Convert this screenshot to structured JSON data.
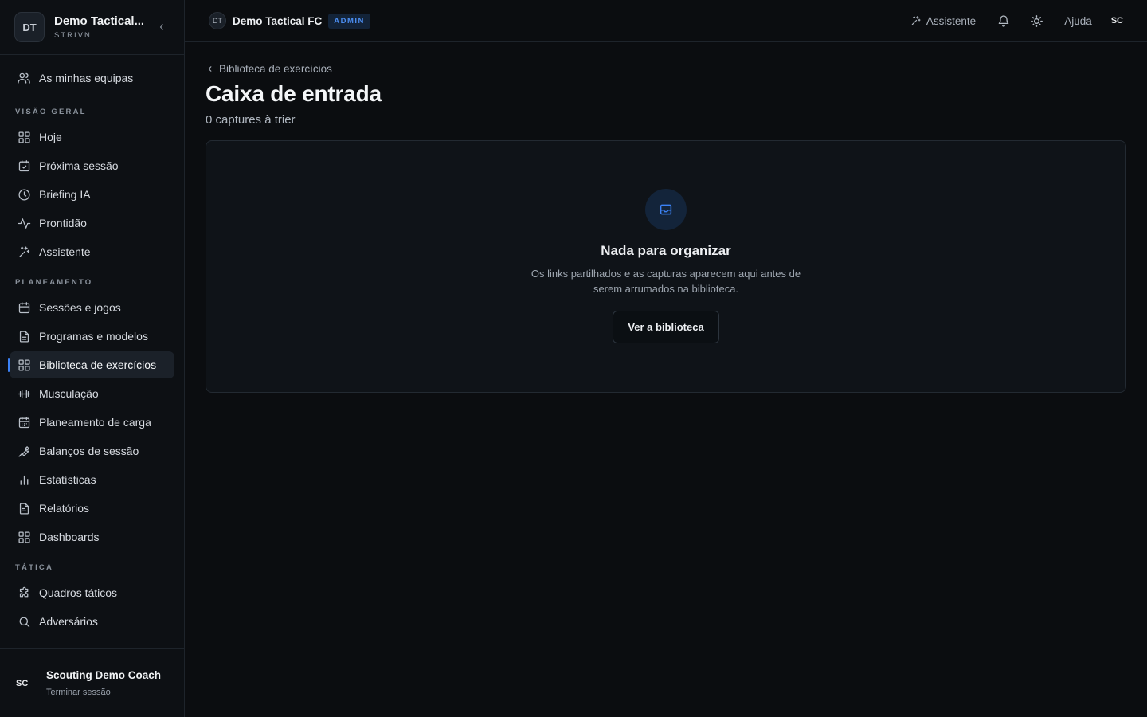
{
  "team": {
    "avatar": "DT",
    "name": "Demo Tactical...",
    "sub": "STRIVN"
  },
  "sidebar": {
    "my_teams": "As minhas equipas",
    "sections": [
      {
        "label": "VISÃO GERAL",
        "items": [
          {
            "label": "Hoje",
            "icon": "grid-icon"
          },
          {
            "label": "Próxima sessão",
            "icon": "calendar-check-icon"
          },
          {
            "label": "Briefing IA",
            "icon": "clock-icon"
          },
          {
            "label": "Prontidão",
            "icon": "activity-icon"
          },
          {
            "label": "Assistente",
            "icon": "sparkles-icon"
          }
        ]
      },
      {
        "label": "PLANEAMENTO",
        "items": [
          {
            "label": "Sessões e jogos",
            "icon": "calendar-icon"
          },
          {
            "label": "Programas e modelos",
            "icon": "document-icon"
          },
          {
            "label": "Biblioteca de exercícios",
            "icon": "grid-icon",
            "active": true
          },
          {
            "label": "Musculação",
            "icon": "dumbbell-icon"
          },
          {
            "label": "Planeamento de carga",
            "icon": "calendar-grid-icon"
          },
          {
            "label": "Balanços de sessão",
            "icon": "wrench-icon"
          },
          {
            "label": "Estatísticas",
            "icon": "bar-chart-icon"
          },
          {
            "label": "Relatórios",
            "icon": "report-icon"
          },
          {
            "label": "Dashboards",
            "icon": "grid-icon"
          }
        ]
      },
      {
        "label": "TÁTICA",
        "items": [
          {
            "label": "Quadros táticos",
            "icon": "puzzle-icon"
          },
          {
            "label": "Adversários",
            "icon": "search-icon"
          }
        ]
      }
    ]
  },
  "user": {
    "initials": "SC",
    "name": "Scouting Demo Coach",
    "logout": "Terminar sessão"
  },
  "topbar": {
    "org_badge": "DT",
    "org_name": "Demo Tactical FC",
    "role": "ADMIN",
    "assistant": "Assistente",
    "help": "Ajuda",
    "user_initials": "SC"
  },
  "main": {
    "breadcrumb": "Biblioteca de exercícios",
    "title": "Caixa de entrada",
    "subtitle": "0 captures à trier",
    "empty": {
      "title": "Nada para organizar",
      "description": "Os links partilhados e as capturas aparecem aqui antes de serem arrumados na biblioteca.",
      "button": "Ver a biblioteca"
    }
  },
  "colors": {
    "accent": "#3b82f6",
    "background": "#0b0d10",
    "sidebar": "#0d1014"
  }
}
